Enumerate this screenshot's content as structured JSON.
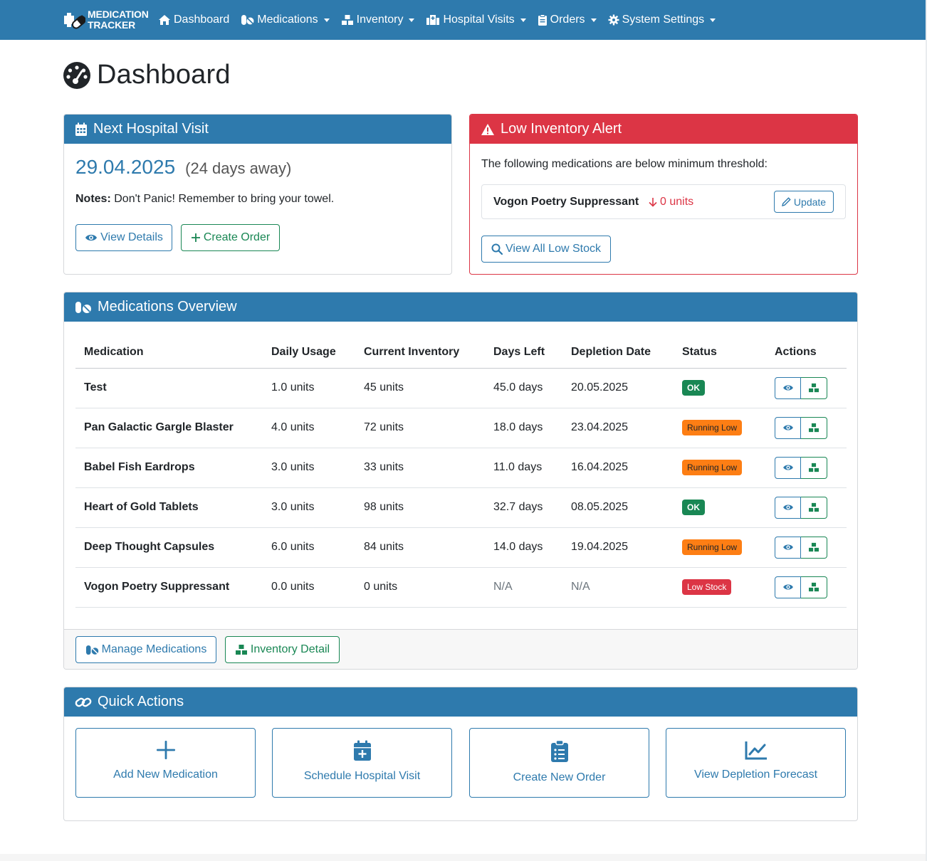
{
  "brand": {
    "line1": "MEDICATION",
    "line2": "TRACKER"
  },
  "nav": [
    {
      "label": "Dashboard",
      "icon": "home-icon"
    },
    {
      "label": "Medications",
      "icon": "pills-icon"
    },
    {
      "label": "Inventory",
      "icon": "boxes-icon"
    },
    {
      "label": "Hospital Visits",
      "icon": "hospital-icon"
    },
    {
      "label": "Orders",
      "icon": "clipboard-icon"
    },
    {
      "label": "System Settings",
      "icon": "gear-icon"
    }
  ],
  "page": {
    "title": "Dashboard"
  },
  "visit": {
    "header": "Next Hospital Visit",
    "date": "29.04.2025",
    "away": "(24 days away)",
    "notes_label": "Notes:",
    "notes": "Don't Panic! Remember to bring your towel.",
    "view_btn": "View Details",
    "order_btn": "Create Order"
  },
  "alert": {
    "header": "Low Inventory Alert",
    "intro": "The following medications are below minimum threshold:",
    "item_name": "Vogon Poetry Suppressant",
    "item_qty": "0 units",
    "update_btn": "Update",
    "view_all_btn": "View All Low Stock"
  },
  "meds": {
    "header": "Medications Overview",
    "columns": [
      "Medication",
      "Daily Usage",
      "Current Inventory",
      "Days Left",
      "Depletion Date",
      "Status",
      "Actions"
    ],
    "rows": [
      {
        "name": "Test",
        "usage": "1.0 units",
        "inventory": "45 units",
        "days": "45.0 days",
        "date": "20.05.2025",
        "status": "OK"
      },
      {
        "name": "Pan Galactic Gargle Blaster",
        "usage": "4.0 units",
        "inventory": "72 units",
        "days": "18.0 days",
        "date": "23.04.2025",
        "status": "Running Low"
      },
      {
        "name": "Babel Fish Eardrops",
        "usage": "3.0 units",
        "inventory": "33 units",
        "days": "11.0 days",
        "date": "16.04.2025",
        "status": "Running Low"
      },
      {
        "name": "Heart of Gold Tablets",
        "usage": "3.0 units",
        "inventory": "98 units",
        "days": "32.7 days",
        "date": "08.05.2025",
        "status": "OK"
      },
      {
        "name": "Deep Thought Capsules",
        "usage": "6.0 units",
        "inventory": "84 units",
        "days": "14.0 days",
        "date": "19.04.2025",
        "status": "Running Low"
      },
      {
        "name": "Vogon Poetry Suppressant",
        "usage": "0.0 units",
        "inventory": "0 units",
        "days": "N/A",
        "date": "N/A",
        "status": "Low Stock"
      }
    ],
    "manage_btn": "Manage Medications",
    "inventory_btn": "Inventory Detail"
  },
  "quick": {
    "header": "Quick Actions",
    "actions": [
      {
        "label": "Add New Medication",
        "icon": "plus-icon"
      },
      {
        "label": "Schedule Hospital Visit",
        "icon": "calendar-plus-icon"
      },
      {
        "label": "Create New Order",
        "icon": "clipboard-list-icon"
      },
      {
        "label": "View Depletion Forecast",
        "icon": "chart-line-icon"
      }
    ]
  },
  "colors": {
    "primary": "#2e7aad",
    "danger": "#dc3545",
    "success": "#198754",
    "warning": "#fd7e14"
  }
}
